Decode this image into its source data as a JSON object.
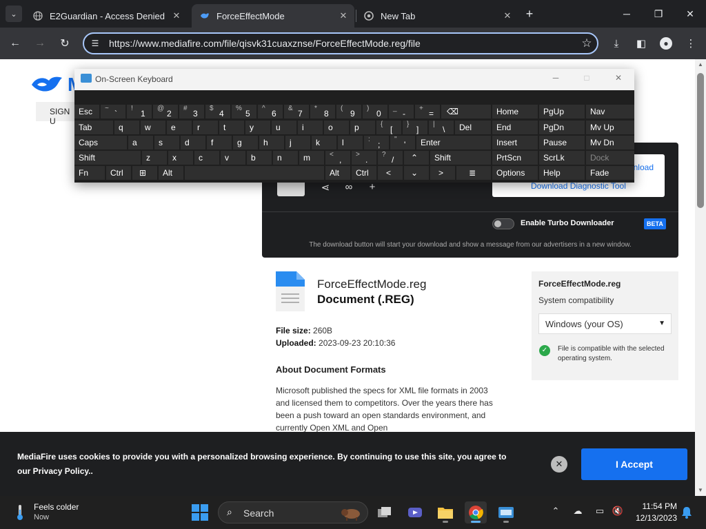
{
  "browser": {
    "tabs": [
      {
        "title": "E2Guardian - Access Denied",
        "active": false
      },
      {
        "title": "ForceEffectMode",
        "active": true
      },
      {
        "title": "New Tab",
        "active": false
      }
    ],
    "new_tab_label": "+",
    "url": "https://www.mediafire.com/file/qisvk31cuaxznse/ForceEffectMode.reg/file"
  },
  "page": {
    "signup_label": "SIGN U",
    "download": {
      "partial_label": "nload",
      "diagnostic_label": "Download Diagnostic Tool",
      "turbo_label": "Enable Turbo Downloader",
      "turbo_enabled": false,
      "beta_badge": "BETA",
      "note": "The download button will start your download and show a message from our advertisers in a new window."
    },
    "file": {
      "name": "ForceEffectMode.reg",
      "type": "Document (.REG)",
      "size_label": "File size:",
      "size_value": "260B",
      "uploaded_label": "Uploaded:",
      "uploaded_value": "2023-09-23 20:10:36"
    },
    "about": {
      "title": "About Document Formats",
      "body": "Microsoft published the specs for XML file formats in 2003 and licensed them to competitors. Over the years there has been a push toward an open standards environment, and currently Open XML and Open"
    },
    "compat": {
      "file_name": "ForceEffectMode.reg",
      "label": "System compatibility",
      "os_value": "Windows (your OS)",
      "message": "File is compatible with the selected operating system."
    },
    "cookie": {
      "text": "MediaFire uses cookies to provide you with a personalized browsing experience. By continuing to use this site, you agree to our Privacy Policy..",
      "accept_label": "I Accept"
    }
  },
  "osk": {
    "title": "On-Screen Keyboard",
    "keys": {
      "esc": "Esc",
      "backtick_s": "~",
      "backtick": "`",
      "n1_s": "!",
      "n1": "1",
      "n2_s": "@",
      "n2": "2",
      "n3_s": "#",
      "n3": "3",
      "n4_s": "$",
      "n4": "4",
      "n5_s": "%",
      "n5": "5",
      "n6_s": "^",
      "n6": "6",
      "n7_s": "&",
      "n7": "7",
      "n8_s": "*",
      "n8": "8",
      "n9_s": "(",
      "n9": "9",
      "n0_s": ")",
      "n0": "0",
      "minus_s": "_",
      "minus": "-",
      "eq_s": "+",
      "eq": "=",
      "backspace": "⌫",
      "tab": "Tab",
      "q": "q",
      "w": "w",
      "e": "e",
      "r": "r",
      "t": "t",
      "y": "y",
      "u": "u",
      "i": "i",
      "o": "o",
      "p": "p",
      "lbr_s": "{",
      "lbr": "[",
      "rbr_s": "}",
      "rbr": "]",
      "bsl_s": "|",
      "bsl": "\\",
      "del": "Del",
      "caps": "Caps",
      "a": "a",
      "s": "s",
      "d": "d",
      "f": "f",
      "g": "g",
      "h": "h",
      "j": "j",
      "k": "k",
      "l": "l",
      "semi_s": ":",
      "semi": ";",
      "quote_s": "\"",
      "quote": "'",
      "enter": "Enter",
      "shift": "Shift",
      "z": "z",
      "x": "x",
      "c": "c",
      "v": "v",
      "b": "b",
      "n": "n",
      "m": "m",
      "comma_s": "<",
      "comma": ",",
      "period_s": ">",
      "period": ".",
      "slash_s": "?",
      "slash": "/",
      "up": "⌃",
      "fn": "Fn",
      "ctrl": "Ctrl",
      "win": "⊞",
      "alt": "Alt",
      "left": "<",
      "down": "⌄",
      "right": ">",
      "menu": "≣",
      "home": "Home",
      "pgup": "PgUp",
      "nav": "Nav",
      "end": "End",
      "pgdn": "PgDn",
      "mvup": "Mv Up",
      "insert": "Insert",
      "pause": "Pause",
      "mvdn": "Mv Dn",
      "prtscn": "PrtScn",
      "scrlk": "ScrLk",
      "dock": "Dock",
      "options": "Options",
      "help": "Help",
      "fade": "Fade"
    }
  },
  "taskbar": {
    "weather_title": "Feels colder",
    "weather_sub": "Now",
    "search_label": "Search",
    "time": "11:54 PM",
    "date": "12/13/2023"
  }
}
